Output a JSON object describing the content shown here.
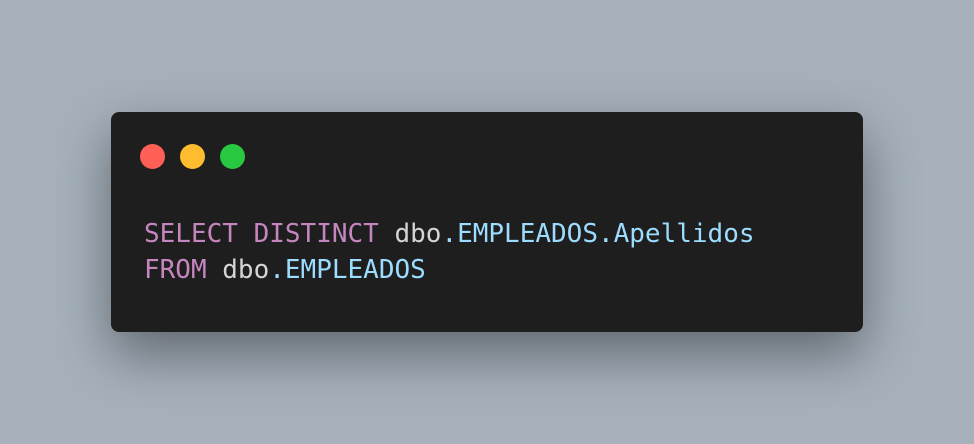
{
  "window": {
    "controls": [
      {
        "name": "close",
        "color": "#ff5f57"
      },
      {
        "name": "minimize",
        "color": "#febc2e"
      },
      {
        "name": "zoom",
        "color": "#28c840"
      }
    ]
  },
  "code": {
    "language": "sql",
    "lines": [
      {
        "tokens": [
          {
            "text": "SELECT",
            "type": "keyword"
          },
          {
            "text": " ",
            "type": "plain"
          },
          {
            "text": "DISTINCT",
            "type": "keyword"
          },
          {
            "text": " dbo",
            "type": "plain"
          },
          {
            "text": ".EMPLEADOS.Apellidos",
            "type": "ident"
          }
        ]
      },
      {
        "tokens": [
          {
            "text": "FROM",
            "type": "keyword"
          },
          {
            "text": " dbo",
            "type": "plain"
          },
          {
            "text": ".EMPLEADOS",
            "type": "ident"
          }
        ]
      }
    ]
  },
  "colors": {
    "background": "#a6b1bc",
    "window": "#1e1e1e",
    "keyword": "#c586c0",
    "plain": "#d4d4d4",
    "identifier": "#9cdcfe"
  }
}
